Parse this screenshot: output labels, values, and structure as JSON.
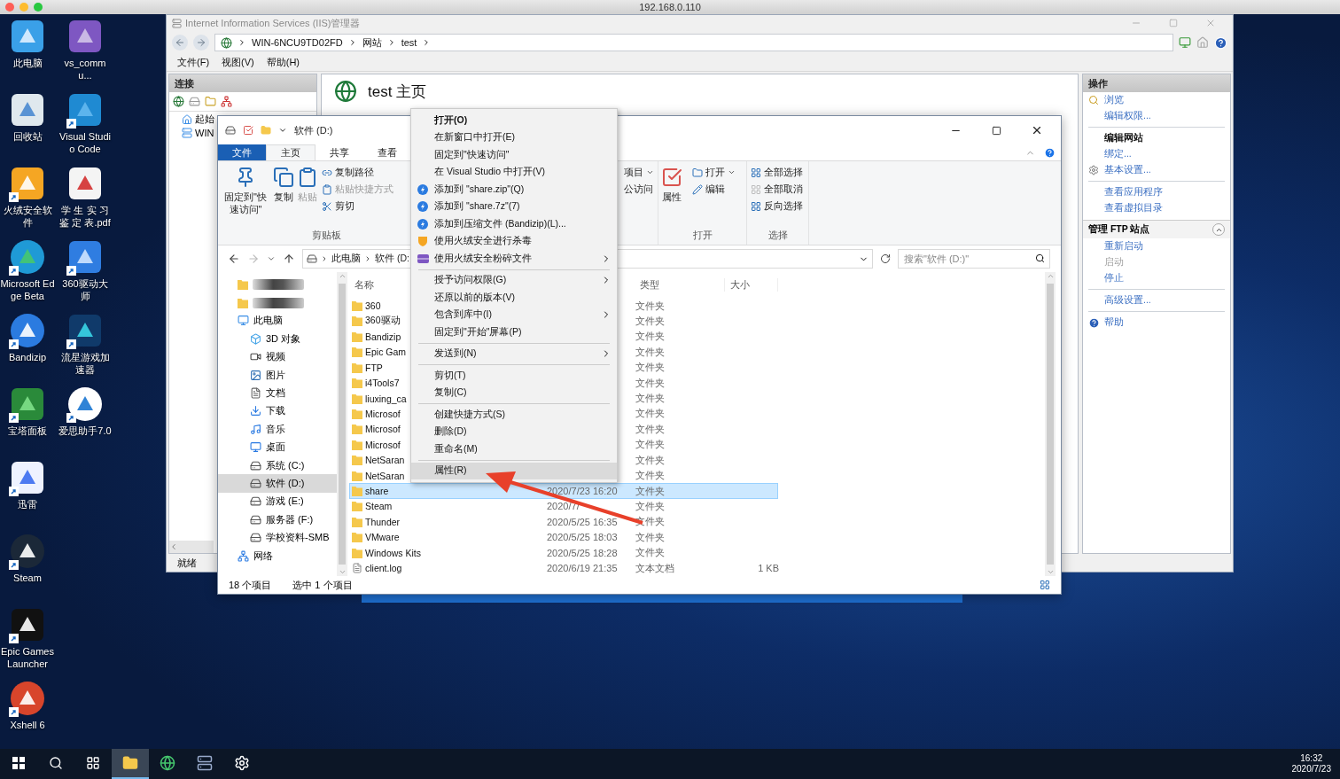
{
  "host_bar": {
    "title": "192.168.0.110"
  },
  "desktop_icons": [
    {
      "label": "此电脑",
      "shortcut": false
    },
    {
      "label": "回收站",
      "shortcut": false
    },
    {
      "label": "火绒安全软件",
      "shortcut": true
    },
    {
      "label": "Microsoft Edge Beta",
      "shortcut": true
    },
    {
      "label": "Bandizip",
      "shortcut": true
    },
    {
      "label": "宝塔面板",
      "shortcut": true
    },
    {
      "label": "迅雷",
      "shortcut": true
    },
    {
      "label": "Steam",
      "shortcut": true
    },
    {
      "label": "Epic Games Launcher",
      "shortcut": true
    },
    {
      "label": "Xshell 6",
      "shortcut": true
    },
    {
      "label": "vs_commu...",
      "shortcut": false
    },
    {
      "label": "Visual Studio Code",
      "shortcut": true
    },
    {
      "label": "学 生 实 习鉴 定 表.pdf",
      "shortcut": false
    },
    {
      "label": "360驱动大师",
      "shortcut": true
    },
    {
      "label": "流星游戏加速器",
      "shortcut": true
    },
    {
      "label": "爱思助手7.0",
      "shortcut": true
    }
  ],
  "iis": {
    "title": "Internet Information Services (IIS)管理器",
    "breadcrumb": [
      "WIN-6NCU9TD02FD",
      "网站",
      "test"
    ],
    "menu": [
      "文件(F)",
      "视图(V)",
      "帮助(H)"
    ],
    "connections": {
      "title": "连接",
      "tree": [
        {
          "label": "起始",
          "kind": "home"
        },
        {
          "label": "WIN",
          "kind": "server"
        }
      ]
    },
    "status": "就绪",
    "page_title": "test 主页",
    "actions": {
      "title": "操作",
      "items": [
        {
          "kind": "link",
          "label": "浏览",
          "disabled": false
        },
        {
          "kind": "link",
          "label": "编辑权限...",
          "disabled": false
        },
        {
          "kind": "separator"
        },
        {
          "kind": "heading",
          "label": "编辑网站"
        },
        {
          "kind": "link",
          "label": "绑定...",
          "disabled": false
        },
        {
          "kind": "link",
          "label": "基本设置...",
          "disabled": false
        },
        {
          "kind": "separator"
        },
        {
          "kind": "link",
          "label": "查看应用程序",
          "disabled": false
        },
        {
          "kind": "link",
          "label": "查看虚拟目录",
          "disabled": false
        },
        {
          "kind": "section",
          "label": "管理 FTP 站点",
          "expanded": true
        },
        {
          "kind": "link",
          "label": "重新启动",
          "disabled": false
        },
        {
          "kind": "link",
          "label": "启动",
          "disabled": true
        },
        {
          "kind": "link",
          "label": "停止",
          "disabled": false
        },
        {
          "kind": "separator"
        },
        {
          "kind": "link",
          "label": "高级设置...",
          "disabled": false
        },
        {
          "kind": "separator"
        },
        {
          "kind": "link",
          "label": "帮助",
          "disabled": false
        }
      ]
    }
  },
  "explorer": {
    "title": "软件 (D:)",
    "tabs": [
      {
        "label": "文件",
        "kind": "file",
        "selected": false
      },
      {
        "label": "主页",
        "kind": "tab",
        "selected": true
      },
      {
        "label": "共享",
        "kind": "tab",
        "selected": false
      },
      {
        "label": "查看",
        "kind": "tab",
        "selected": false
      }
    ],
    "ribbon": [
      {
        "label": "剪贴板",
        "items": [
          {
            "label": "固定到\"快速访问\"",
            "kind": "large",
            "disabled": false
          },
          {
            "label": "复制",
            "kind": "large",
            "disabled": false
          },
          {
            "label": "粘贴",
            "kind": "large",
            "disabled": true
          },
          {
            "label": "复制路径",
            "kind": "small",
            "disabled": false
          },
          {
            "label": "粘贴快捷方式",
            "kind": "small",
            "disabled": true
          },
          {
            "label": "剪切",
            "kind": "small",
            "disabled": false
          }
        ]
      },
      {
        "items": [
          {
            "label": "项目",
            "kind": "small",
            "dropdown": true,
            "disabled": false
          },
          {
            "label": "公访问",
            "kind": "small",
            "dropdown": false,
            "disabled": false
          }
        ]
      },
      {
        "label": "打开",
        "items": [
          {
            "label": "属性",
            "kind": "large",
            "disabled": false
          },
          {
            "label": "打开",
            "kind": "small",
            "dropdown": true,
            "disabled": false
          },
          {
            "label": "编辑",
            "kind": "small",
            "dropdown": false,
            "disabled": false
          }
        ]
      },
      {
        "label": "选择",
        "items": [
          {
            "label": "全部选择",
            "kind": "small",
            "disabled": false
          },
          {
            "label": "全部取消",
            "kind": "small",
            "disabled": false
          },
          {
            "label": "反向选择",
            "kind": "small",
            "disabled": false
          }
        ]
      }
    ],
    "path": [
      "此电脑",
      "软件 (D:"
    ],
    "search": {
      "placeholder": "搜索\"软件 (D:)\""
    },
    "nav": [
      {
        "kind": "redacted"
      },
      {
        "kind": "redacted"
      },
      {
        "kind": "pc",
        "label": "此电脑",
        "selected": false,
        "children": [
          {
            "kind": "object",
            "label": "3D 对象",
            "selected": false
          },
          {
            "kind": "video",
            "label": "视频",
            "selected": false
          },
          {
            "kind": "image",
            "label": "图片",
            "selected": false
          },
          {
            "kind": "doc",
            "label": "文档",
            "selected": false
          },
          {
            "kind": "download",
            "label": "下载",
            "selected": false
          },
          {
            "kind": "music",
            "label": "音乐",
            "selected": false
          },
          {
            "kind": "desktop",
            "label": "桌面",
            "selected": false
          },
          {
            "kind": "system",
            "label": "系统 (C:)",
            "selected": false
          },
          {
            "kind": "drive",
            "label": "软件 (D:)",
            "selected": true
          },
          {
            "kind": "drive",
            "label": "游戏 (E:)",
            "selected": false
          },
          {
            "kind": "drive",
            "label": "服务器 (F:)",
            "selected": false
          },
          {
            "kind": "drive",
            "label": "学校资料-SMB",
            "selected": false
          }
        ]
      },
      {
        "kind": "network",
        "label": "网络",
        "selected": false
      }
    ],
    "columns": [
      "名称",
      "类型",
      "大小"
    ],
    "files": [
      {
        "name": "360",
        "type": "文件夹",
        "kind": "folder",
        "selected": false
      },
      {
        "name": "360驱动",
        "type": "文件夹",
        "kind": "folder",
        "selected": false
      },
      {
        "name": "Bandizip",
        "type": "文件夹",
        "kind": "folder",
        "selected": false
      },
      {
        "name": "Epic Gam",
        "type": "文件夹",
        "kind": "folder",
        "selected": false
      },
      {
        "name": "FTP",
        "type": "文件夹",
        "kind": "folder",
        "selected": false
      },
      {
        "name": "i4Tools7",
        "type": "文件夹",
        "kind": "folder",
        "selected": false
      },
      {
        "name": "liuxing_ca",
        "type": "文件夹",
        "kind": "folder",
        "selected": false
      },
      {
        "name": "Microsof",
        "type": "文件夹",
        "kind": "folder",
        "selected": false
      },
      {
        "name": "Microsof",
        "type": "文件夹",
        "kind": "folder",
        "selected": false
      },
      {
        "name": "Microsof",
        "type": "文件夹",
        "kind": "folder",
        "selected": false
      },
      {
        "name": "NetSaran",
        "type": "文件夹",
        "kind": "folder",
        "selected": false
      },
      {
        "name": "NetSaran",
        "type": "文件夹",
        "kind": "folder",
        "selected": false
      },
      {
        "name": "share",
        "date": "2020/7/23 16:20",
        "type": "文件夹",
        "kind": "folder",
        "selected": true
      },
      {
        "name": "Steam",
        "date": "2020/7/",
        "type": "文件夹",
        "kind": "folder",
        "selected": false
      },
      {
        "name": "Thunder",
        "date": "2020/5/25 16:35",
        "type": "文件夹",
        "kind": "folder",
        "selected": false
      },
      {
        "name": "VMware",
        "date": "2020/5/25 18:03",
        "type": "文件夹",
        "kind": "folder",
        "selected": false
      },
      {
        "name": "Windows Kits",
        "date": "2020/5/25 18:28",
        "type": "文件夹",
        "kind": "folder",
        "selected": false
      },
      {
        "name": "client.log",
        "date": "2020/6/19 21:35",
        "type": "文本文档",
        "size": "1 KB",
        "kind": "file",
        "selected": false
      }
    ],
    "status": [
      "18 个项目",
      "选中 1 个项目"
    ]
  },
  "context_menu": [
    {
      "kind": "item",
      "label": "打开(O)",
      "default": true,
      "submenu": false,
      "selected": false
    },
    {
      "kind": "item",
      "label": "在新窗口中打开(E)",
      "default": false,
      "submenu": false,
      "selected": false
    },
    {
      "kind": "item",
      "label": "固定到\"快速访问\"",
      "default": false,
      "submenu": false,
      "selected": false
    },
    {
      "kind": "item",
      "label": "在 Visual Studio 中打开(V)",
      "default": false,
      "submenu": false,
      "selected": false
    },
    {
      "kind": "item",
      "label": "添加到 \"share.zip\"(Q)",
      "default": false,
      "submenu": false,
      "selected": false
    },
    {
      "kind": "item",
      "label": "添加到 \"share.7z\"(7)",
      "default": false,
      "submenu": false,
      "selected": false
    },
    {
      "kind": "item",
      "label": "添加到压缩文件 (Bandizip)(L)...",
      "default": false,
      "submenu": false,
      "selected": false
    },
    {
      "kind": "item",
      "label": "使用火绒安全进行杀毒",
      "default": false,
      "submenu": false,
      "selected": false
    },
    {
      "kind": "item",
      "label": "使用火绒安全粉碎文件",
      "default": false,
      "submenu": true,
      "selected": false
    },
    {
      "kind": "separator"
    },
    {
      "kind": "item",
      "label": "授予访问权限(G)",
      "default": false,
      "submenu": true,
      "selected": false
    },
    {
      "kind": "item",
      "label": "还原以前的版本(V)",
      "default": false,
      "submenu": false,
      "selected": false
    },
    {
      "kind": "item",
      "label": "包含到库中(I)",
      "default": false,
      "submenu": true,
      "selected": false
    },
    {
      "kind": "item",
      "label": "固定到\"开始\"屏幕(P)",
      "default": false,
      "submenu": false,
      "selected": false
    },
    {
      "kind": "separator"
    },
    {
      "kind": "item",
      "label": "发送到(N)",
      "default": false,
      "submenu": true,
      "selected": false
    },
    {
      "kind": "separator"
    },
    {
      "kind": "item",
      "label": "剪切(T)",
      "default": false,
      "submenu": false,
      "selected": false
    },
    {
      "kind": "item",
      "label": "复制(C)",
      "default": false,
      "submenu": false,
      "selected": false
    },
    {
      "kind": "separator"
    },
    {
      "kind": "item",
      "label": "创建快捷方式(S)",
      "default": false,
      "submenu": false,
      "selected": false
    },
    {
      "kind": "item",
      "label": "删除(D)",
      "default": false,
      "submenu": false,
      "selected": false
    },
    {
      "kind": "item",
      "label": "重命名(M)",
      "default": false,
      "submenu": false,
      "selected": false
    },
    {
      "kind": "separator"
    },
    {
      "kind": "item",
      "label": "属性(R)",
      "default": false,
      "submenu": false,
      "selected": true
    }
  ],
  "taskbar": {
    "apps": [
      {
        "kind": "start",
        "selected": false
      },
      {
        "kind": "search",
        "selected": false
      },
      {
        "kind": "taskview",
        "selected": false
      },
      {
        "kind": "explorer",
        "selected": true
      },
      {
        "kind": "edge",
        "selected": false
      },
      {
        "kind": "iis",
        "selected": false
      },
      {
        "kind": "settings",
        "selected": false
      }
    ],
    "time": "16:32",
    "date": "2020/7/23"
  }
}
